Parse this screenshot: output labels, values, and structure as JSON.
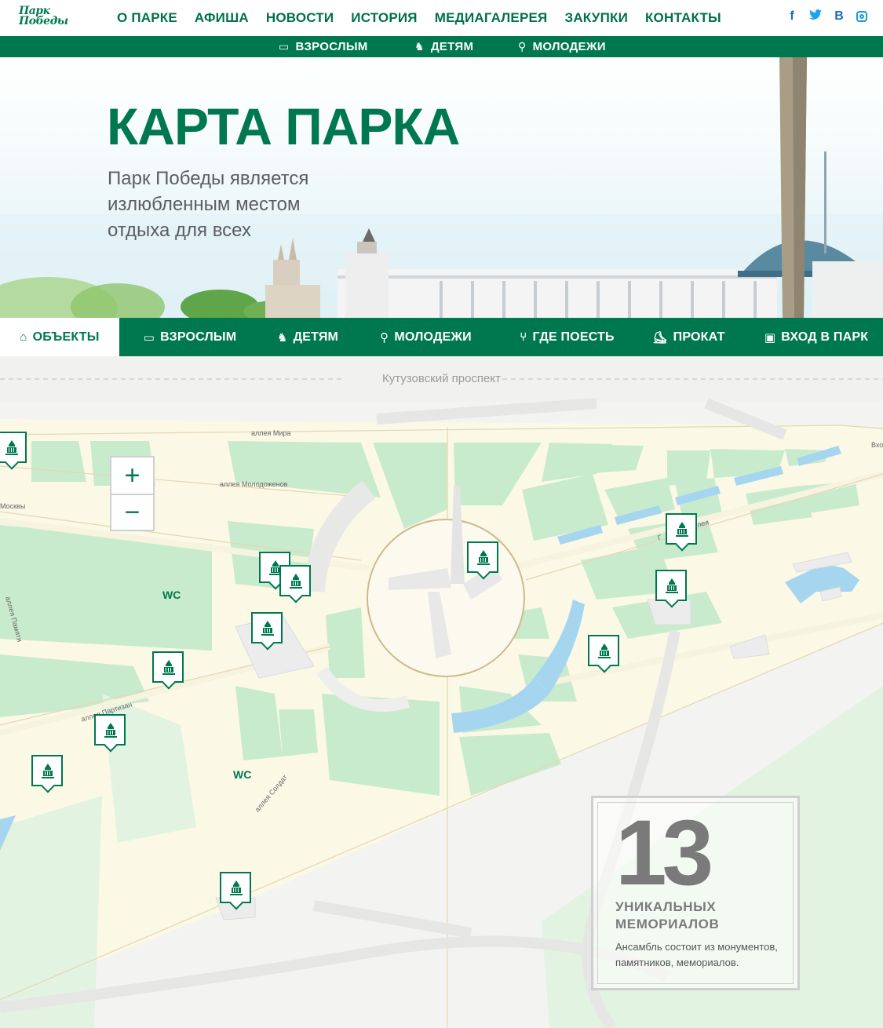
{
  "logo": {
    "line1": "Парк",
    "line2": "Победы"
  },
  "main_nav": [
    "О ПАРКЕ",
    "АФИША",
    "НОВОСТИ",
    "ИСТОРИЯ",
    "МЕДИАГАЛЕРЕЯ",
    "ЗАКУПКИ",
    "КОНТАКТЫ"
  ],
  "social": {
    "facebook": "f",
    "twitter": "twitter-icon",
    "vk": "В",
    "instagram": "instagram-icon"
  },
  "sub_nav": [
    {
      "label": "ВЗРОСЛЫМ",
      "icon": "bench-icon"
    },
    {
      "label": "ДЕТЯМ",
      "icon": "rocking-horse-icon"
    },
    {
      "label": "МОЛОДЕЖИ",
      "icon": "bicycle-icon"
    }
  ],
  "hero": {
    "title": "КАРТА ПАРКА",
    "subtitle": "Парк Победы является излюбленным местом отдыха для всех"
  },
  "category_tabs": [
    {
      "label": "ОБЪЕКТЫ",
      "icon": "monument-icon",
      "active": true
    },
    {
      "label": "ВЗРОСЛЫМ",
      "icon": "bench-icon",
      "active": false
    },
    {
      "label": "ДЕТЯМ",
      "icon": "rocking-horse-icon",
      "active": false
    },
    {
      "label": "МОЛОДЕЖИ",
      "icon": "bicycle-icon",
      "active": false
    },
    {
      "label": "ГДЕ ПОЕСТЬ",
      "icon": "fork-knife-icon",
      "active": false
    },
    {
      "label": "ПРОКАТ",
      "icon": "scooter-icon",
      "active": false
    },
    {
      "label": "ВХОД В ПАРК",
      "icon": "gate-icon",
      "active": false
    }
  ],
  "map": {
    "street": "Кутузовский проспект",
    "labels": [
      "аллея Мира",
      "аллея Молодоженов",
      "Москвы",
      "аллея Памяти",
      "аллея Партизан",
      "аллея Солдат",
      "Вхо",
      "Г",
      "лея"
    ],
    "wc": [
      "WC",
      "WC"
    ],
    "zoom_in": "+",
    "zoom_out": "−",
    "pin_icon": "monument-icon",
    "pin_count": 13
  },
  "stat": {
    "number": "13",
    "caption": "УНИКАЛЬНЫХ МЕМОРИАЛОВ",
    "description": "Ансамбль состоит из монументов, памятников, мемориалов."
  },
  "colors": {
    "brand": "#00784f",
    "park_green": "#c9ebcd",
    "road": "#fbf8e6",
    "water": "#a6d6ef"
  }
}
